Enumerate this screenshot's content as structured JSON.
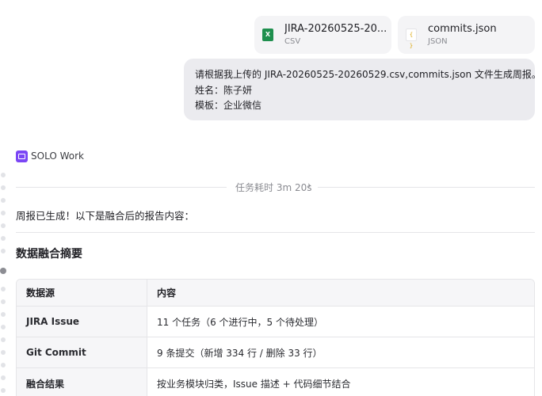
{
  "attachments": [
    {
      "name": "JIRA-20260525-20...",
      "type": "CSV",
      "icon": "excel-file-icon"
    },
    {
      "name": "commits.json",
      "type": "JSON",
      "icon": "json-file-icon"
    }
  ],
  "user_message": {
    "lines": [
      "请根据我上传的 JIRA-20260525-20260529.csv,commits.json 文件生成周报。",
      "姓名：陈子妍",
      "模板：企业微信"
    ]
  },
  "agent": {
    "name": "SOLO Work",
    "icon": "solo-work-icon"
  },
  "task_timer": {
    "label": "任务耗时 3m 20s",
    "chevron": "›"
  },
  "response": {
    "intro": "周报已生成！以下是融合后的报告内容：",
    "section_title": "数据融合摘要",
    "table": {
      "headers": [
        "数据源",
        "内容"
      ],
      "rows": [
        [
          "JIRA Issue",
          "11 个任务（6 个进行中，5 个待处理）"
        ],
        [
          "Git Commit",
          "9 条提交（新增 334 行 / 删除 33 行）"
        ],
        [
          "融合结果",
          "按业务模块归类，Issue 描述 + 代码细节结合"
        ]
      ]
    }
  }
}
